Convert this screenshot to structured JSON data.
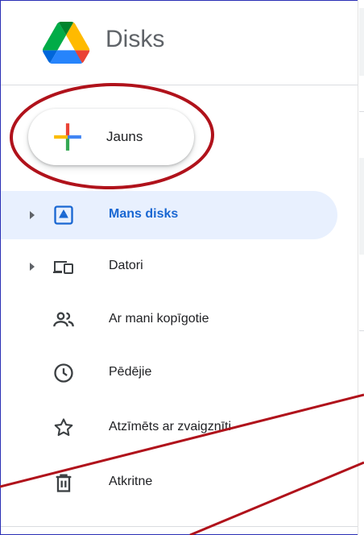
{
  "app": {
    "name": "Disks"
  },
  "new_button": {
    "label": "Jauns"
  },
  "nav": {
    "items": [
      {
        "label": "Mans disks",
        "icon": "my-drive-icon",
        "active": true,
        "expandable": true
      },
      {
        "label": "Datori",
        "icon": "computers-icon",
        "active": false,
        "expandable": true
      },
      {
        "label": "Ar mani kopīgotie",
        "icon": "shared-with-me-icon",
        "active": false,
        "expandable": false
      },
      {
        "label": "Pēdējie",
        "icon": "recent-clock-icon",
        "active": false,
        "expandable": false
      },
      {
        "label": "Atzīmēts ar zvaigznīti",
        "icon": "star-icon",
        "active": false,
        "expandable": false
      },
      {
        "label": "Atkritne",
        "icon": "trash-icon",
        "active": false,
        "expandable": false
      }
    ]
  },
  "colors": {
    "accent": "#1967d2",
    "active_bg": "#e8f0fe",
    "annotation": "#b0121b"
  }
}
